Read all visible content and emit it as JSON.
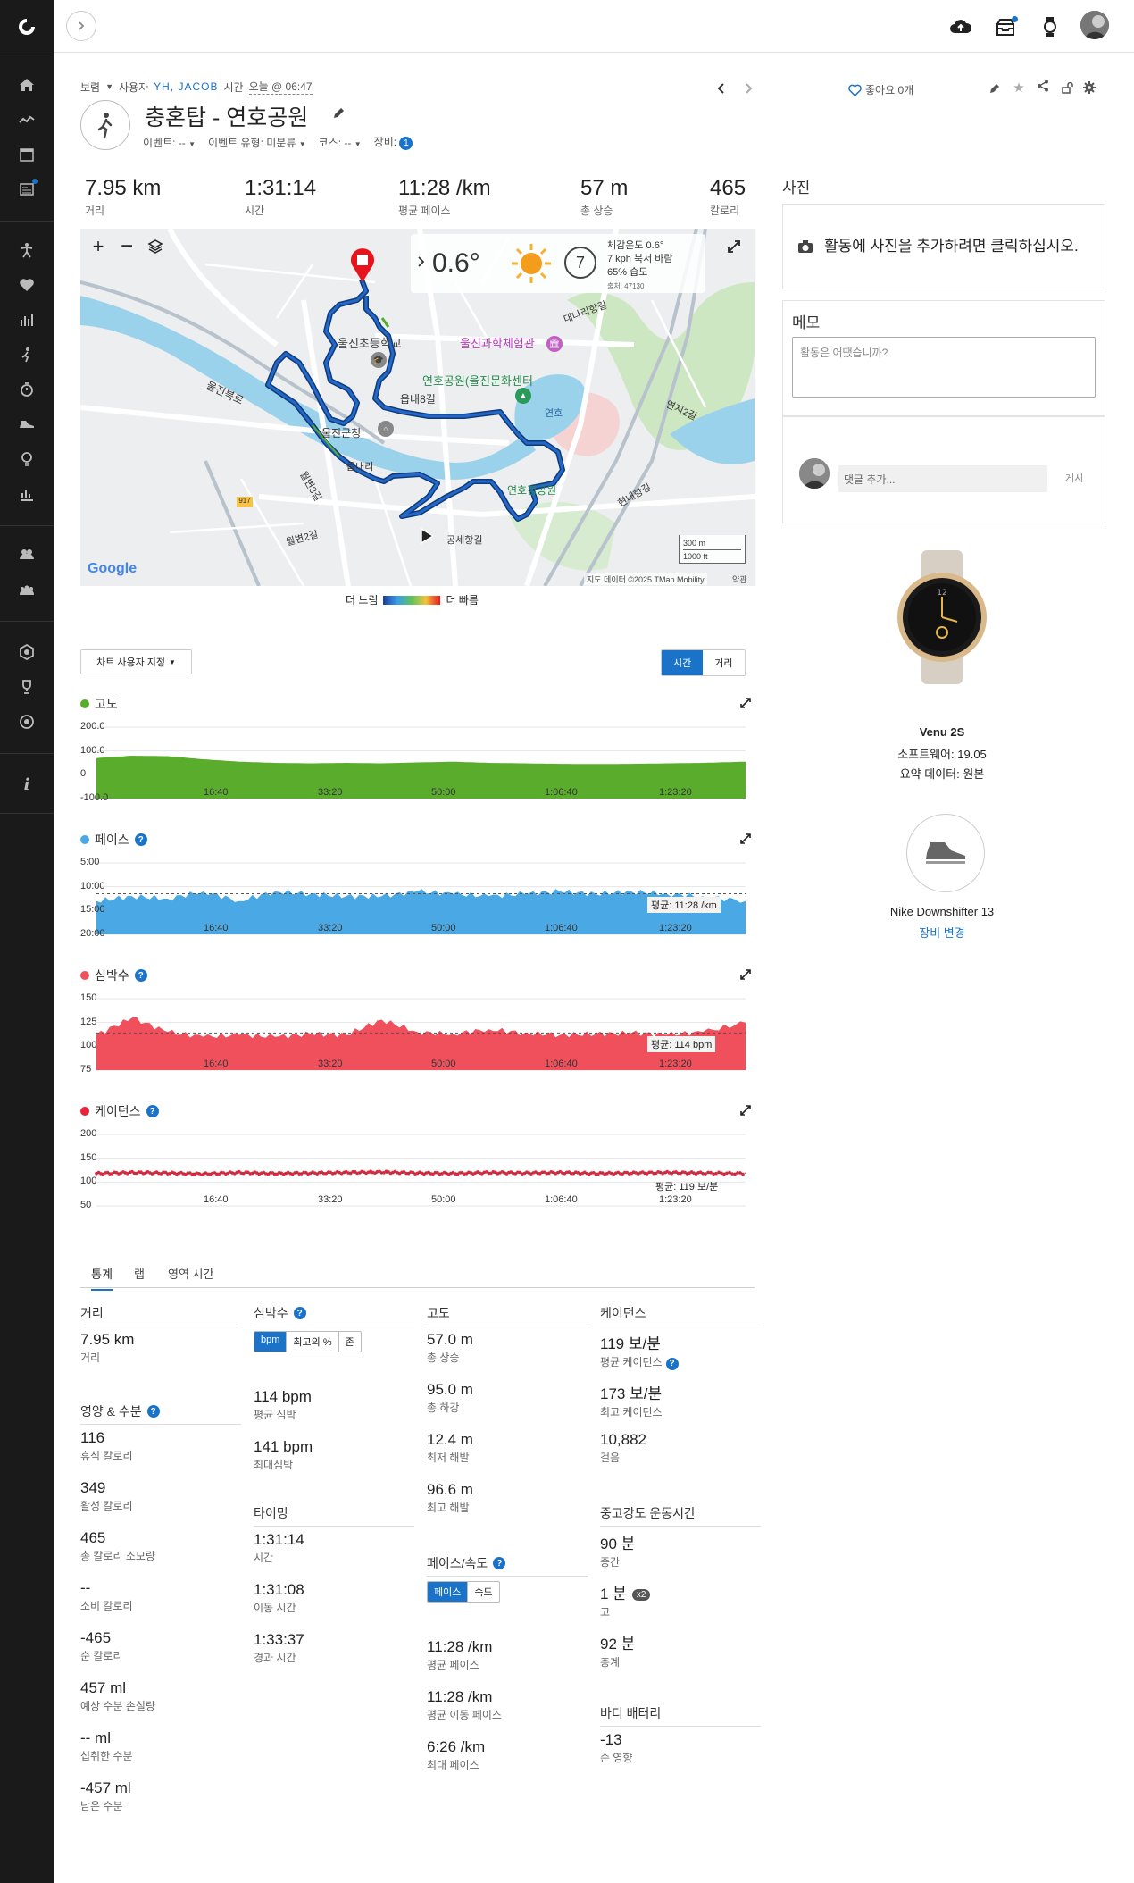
{
  "header": {
    "visibility": "보렴",
    "user_label": "사용자",
    "user_name": "YH, JACOB",
    "time_prefix": "시간",
    "time_value": "오늘 @ 06:47",
    "title": "충혼탑 - 연호공원",
    "event": "이벤트: --",
    "event_type": "이벤트 유형: 미분류",
    "course": "코스: --",
    "gear": "장비:",
    "gear_count": "1",
    "likes": "좋아요 0개"
  },
  "summary": [
    {
      "value": "7.95 km",
      "label": "거리"
    },
    {
      "value": "1:31:14",
      "label": "시간"
    },
    {
      "value": "11:28 /km",
      "label": "평균 페이스"
    },
    {
      "value": "57 m",
      "label": "총 상승"
    },
    {
      "value": "465",
      "label": "칼로리"
    }
  ],
  "weather": {
    "temp": "0.6°",
    "wind_num": "7",
    "line1": "체감온도 0.6°",
    "line2": "7 kph 북서 바람",
    "line3": "65% 습도",
    "station": "출처: 47130"
  },
  "map": {
    "scale1": "300 m",
    "scale2": "1000 ft",
    "attribution": "지도 데이터 ©2025 TMap Mobility",
    "terms": "약관",
    "google": "Google",
    "slow": "더 느림",
    "fast": "더 빠름",
    "labels": {
      "school": "울진초등학교",
      "science": "울진과학체험관",
      "park": "연호공원(울진문화센터",
      "lake": "연호",
      "gunchung": "울진군청",
      "eupnae8": "읍내8길",
      "eupnaeri": "읍내리",
      "hoho": "연호정공원",
      "gongse": "공세항길",
      "wolbyeon": "월변2길",
      "wolbyeon3": "월변3길",
      "uljinbuk": "울진북로",
      "daenaeri": "대나리항길",
      "yeonji": "연지2길",
      "hyeondae": "현내항길"
    }
  },
  "photos": {
    "title": "사진",
    "add_text": "활동에 사진을 추가하려면 클릭하십시오."
  },
  "memo": {
    "title": "메모",
    "placeholder": "활동은 어땠습니까?"
  },
  "comment": {
    "placeholder": "댓글 추가...",
    "post": "게시"
  },
  "device": {
    "name": "Venu 2S",
    "software": "소프트웨어: 19.05",
    "summary": "요약 데이터: 원본"
  },
  "shoe": {
    "name": "Nike Downshifter 13",
    "change": "장비 변경"
  },
  "chart_controls": {
    "customize": "차트 사용자 지정",
    "time": "시간",
    "distance": "거리"
  },
  "chart_data": [
    {
      "type": "area",
      "title": "고도",
      "color": "#5aad2c",
      "yticks": [
        "200.0",
        "100.0",
        "0",
        "-100.0"
      ],
      "ylim": [
        -100,
        200
      ],
      "xticks": [
        "16:40",
        "33:20",
        "50:00",
        "1:06:40",
        "1:23:20"
      ],
      "x_min": [
        0,
        5,
        10,
        15,
        20,
        25,
        30,
        35,
        40,
        45,
        50,
        55,
        60,
        65,
        70,
        75,
        80,
        85,
        91
      ],
      "y": [
        70,
        80,
        78,
        65,
        55,
        50,
        48,
        50,
        48,
        52,
        55,
        50,
        48,
        46,
        45,
        46,
        48,
        50,
        55
      ]
    },
    {
      "type": "area",
      "title": "페이스",
      "color": "#4aa8e4",
      "yticks": [
        "5:00",
        "10:00",
        "15:00",
        "20:00"
      ],
      "ylim": [
        "5:00",
        "20:00"
      ],
      "xticks": [
        "16:40",
        "33:20",
        "50:00",
        "1:06:40",
        "1:23:20"
      ],
      "average": "평균: 11:28 /km",
      "x_min": [
        0,
        5,
        10,
        15,
        20,
        25,
        30,
        35,
        40,
        45,
        50,
        55,
        60,
        65,
        70,
        75,
        80,
        85,
        91
      ],
      "y": [
        "13:00",
        "12:00",
        "12:30",
        "11:00",
        "13:00",
        "11:00",
        "11:30",
        "12:00",
        "12:00",
        "11:00",
        "11:30",
        "12:00",
        "11:30",
        "11:00",
        "11:30",
        "11:00",
        "11:30",
        "12:00",
        "13:00"
      ]
    },
    {
      "type": "area",
      "title": "심박수",
      "color": "#f0505c",
      "yticks": [
        "150",
        "125",
        "100",
        "75"
      ],
      "ylim": [
        75,
        150
      ],
      "xticks": [
        "16:40",
        "33:20",
        "50:00",
        "1:06:40",
        "1:23:20"
      ],
      "average": "평균: 114 bpm",
      "x_min": [
        0,
        5,
        10,
        15,
        20,
        25,
        30,
        35,
        40,
        45,
        50,
        55,
        60,
        65,
        70,
        75,
        80,
        85,
        91
      ],
      "y": [
        112,
        130,
        115,
        110,
        112,
        110,
        113,
        112,
        128,
        115,
        113,
        118,
        114,
        112,
        113,
        114,
        112,
        115,
        125
      ]
    },
    {
      "type": "scatter",
      "title": "케이던스",
      "color": "#e8243c",
      "yticks": [
        "200",
        "150",
        "100",
        "50"
      ],
      "ylim": [
        50,
        200
      ],
      "xticks": [
        "16:40",
        "33:20",
        "50:00",
        "1:06:40",
        "1:23:20"
      ],
      "average": "평균: 119 보/분",
      "x_min": [
        0,
        5,
        10,
        15,
        20,
        25,
        30,
        35,
        40,
        45,
        50,
        55,
        60,
        65,
        70,
        75,
        80,
        85,
        91
      ],
      "y": [
        118,
        120,
        119,
        117,
        120,
        118,
        119,
        120,
        121,
        119,
        118,
        120,
        119,
        120,
        118,
        119,
        120,
        119,
        118
      ]
    }
  ],
  "tabs": [
    "통계",
    "랩",
    "영역 시간"
  ],
  "stats": {
    "distance": {
      "head": "거리",
      "items": [
        {
          "v": "7.95 km",
          "l": "거리"
        }
      ]
    },
    "nutrition": {
      "head": "영양 & 수분",
      "items": [
        {
          "v": "116",
          "l": "휴식 칼로리"
        },
        {
          "v": "349",
          "l": "활성 칼로리"
        },
        {
          "v": "465",
          "l": "총 칼로리 소모량"
        },
        {
          "v": "--",
          "l": "소비 칼로리"
        },
        {
          "v": "-465",
          "l": "순 칼로리"
        },
        {
          "v": "457 ml",
          "l": "예상 수분 손실량"
        },
        {
          "v": "-- ml",
          "l": "섭취한 수분"
        },
        {
          "v": "-457 ml",
          "l": "남은 수분"
        }
      ]
    },
    "heartrate": {
      "head": "심박수",
      "toggle": [
        "bpm",
        "최고의 %",
        "존"
      ],
      "items": [
        {
          "v": "114 bpm",
          "l": "평균 심박"
        },
        {
          "v": "141 bpm",
          "l": "최대심박"
        }
      ]
    },
    "timing": {
      "head": "타이밍",
      "items": [
        {
          "v": "1:31:14",
          "l": "시간"
        },
        {
          "v": "1:31:08",
          "l": "이동 시간"
        },
        {
          "v": "1:33:37",
          "l": "경과 시간"
        }
      ]
    },
    "elevation": {
      "head": "고도",
      "items": [
        {
          "v": "57.0 m",
          "l": "총 상승"
        },
        {
          "v": "95.0 m",
          "l": "총 하강"
        },
        {
          "v": "12.4 m",
          "l": "최저 해발"
        },
        {
          "v": "96.6 m",
          "l": "최고 해발"
        }
      ]
    },
    "pace": {
      "head": "페이스/속도",
      "toggle": [
        "페이스",
        "속도"
      ],
      "items": [
        {
          "v": "11:28 /km",
          "l": "평균 페이스"
        },
        {
          "v": "11:28 /km",
          "l": "평균 이동 페이스"
        },
        {
          "v": "6:26 /km",
          "l": "최대 페이스"
        }
      ]
    },
    "cadence": {
      "head": "케이던스",
      "items": [
        {
          "v": "119 보/분",
          "l": "평균 케이던스"
        },
        {
          "v": "173 보/분",
          "l": "최고 케이던스"
        },
        {
          "v": "10,882",
          "l": "걸음"
        }
      ]
    },
    "intensity": {
      "head": "중고강도 운동시간",
      "items": [
        {
          "v": "90 분",
          "l": "중간"
        },
        {
          "v": "1 분",
          "l": "고",
          "badge": "x2"
        },
        {
          "v": "92 분",
          "l": "총계"
        }
      ]
    },
    "body": {
      "head": "바디 배터리",
      "items": [
        {
          "v": "-13",
          "l": "순 영향"
        }
      ]
    }
  }
}
